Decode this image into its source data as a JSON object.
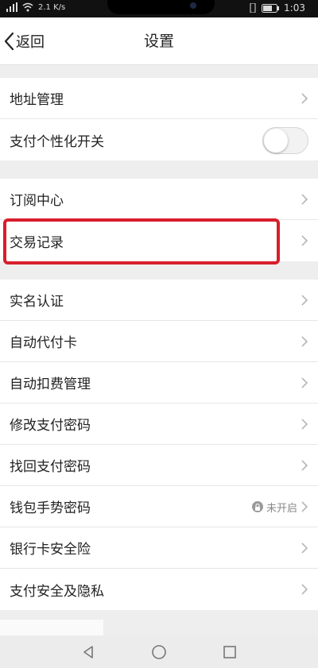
{
  "status_bar": {
    "network": "2.1 K/s",
    "time": "1:03",
    "icons": [
      "signal-icon",
      "wifi-icon",
      "vibrate-icon",
      "battery-icon"
    ]
  },
  "nav": {
    "back_label": "返回",
    "title": "设置"
  },
  "sections": [
    {
      "items": [
        {
          "label": "地址管理",
          "type": "link"
        },
        {
          "label": "支付个性化开关",
          "type": "toggle",
          "on": false
        }
      ]
    },
    {
      "items": [
        {
          "label": "订阅中心",
          "type": "link"
        },
        {
          "label": "交易记录",
          "type": "link",
          "highlighted": true
        }
      ]
    },
    {
      "items": [
        {
          "label": "实名认证",
          "type": "link"
        },
        {
          "label": "自动代付卡",
          "type": "link"
        },
        {
          "label": "自动扣费管理",
          "type": "link"
        },
        {
          "label": "修改支付密码",
          "type": "link"
        },
        {
          "label": "找回支付密码",
          "type": "link"
        },
        {
          "label": "钱包手势密码",
          "type": "link",
          "status": "未开启"
        },
        {
          "label": "银行卡安全险",
          "type": "link"
        },
        {
          "label": "支付安全及隐私",
          "type": "link"
        }
      ]
    }
  ],
  "colors": {
    "highlight": "#d81e2c",
    "background": "#eeeeee"
  }
}
